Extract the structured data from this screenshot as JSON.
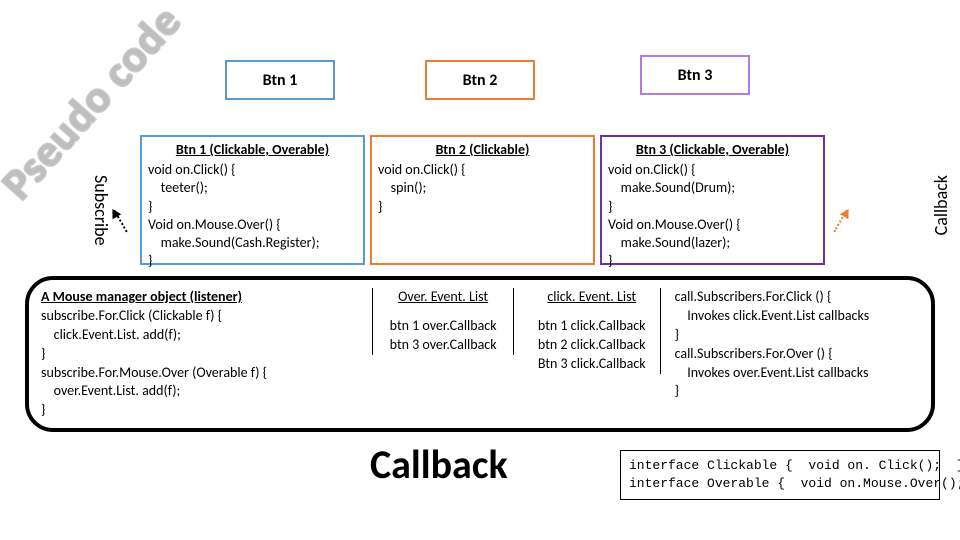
{
  "watermark": "Pseudo code",
  "side_labels": {
    "subscribe": "Subscribe",
    "callback": "Callback"
  },
  "buttons": {
    "b1": "Btn 1",
    "b2": "Btn 2",
    "b3": "Btn 3"
  },
  "code_boxes": {
    "b1": {
      "title": "Btn 1 (Clickable, Overable)",
      "body": "void on.Click() {\n    teeter();\n}\nVoid on.Mouse.Over() {\n    make.Sound(Cash.Register);\n}"
    },
    "b2": {
      "title": "Btn 2 (Clickable)",
      "body": "void on.Click() {\n    spin();\n}"
    },
    "b3": {
      "title": "Btn 3 (Clickable, Overable)",
      "body": "void on.Click() {\n    make.Sound(Drum);\n}\nVoid on.Mouse.Over() {\n    make.Sound(lazer);\n}"
    }
  },
  "listener": {
    "title": "A Mouse manager object (listener)",
    "body": "subscribe.For.Click (Clickable f) {\n    click.Event.List. add(f);\n}\nsubscribe.For.Mouse.Over (Overable f) {\n    over.Event.List. add(f);\n}",
    "over_header": "Over. Event. List",
    "over_body": "btn 1 over.Callback\nbtn 3 over.Callback",
    "click_header": "click. Event. List",
    "click_body": "btn 1 click.Callback\nbtn 2 click.Callback\nBtn 3 click.Callback",
    "invoke_body": "call.Subscribers.For.Click () {\n    Invokes click.Event.List callbacks\n}\ncall.Subscribers.For.Over () {\n    Invokes over.Event.List callbacks\n}"
  },
  "callback_label": "Callback",
  "interfaces": "interface Clickable {  void on. Click();  }\ninterface Overable {  void on.Mouse.Over(); }"
}
